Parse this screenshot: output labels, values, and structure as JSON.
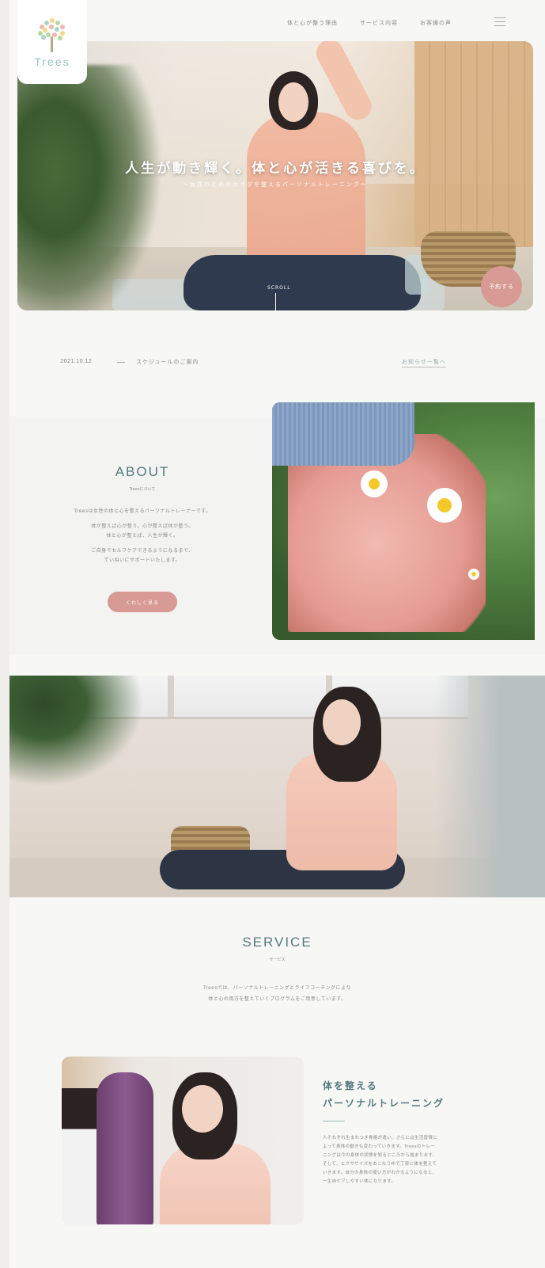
{
  "header": {
    "logo_text": "Trees",
    "nav": [
      "体と心が整う理由",
      "サービス内容",
      "お客様の声"
    ]
  },
  "hero": {
    "title": "人生が動き輝く。体と心が活きる喜びを。",
    "subtitle": "〜女性のためのカラダを整えるパーソナルトレーニング〜",
    "scroll_label": "SCROLL",
    "reserve_label": "予約する"
  },
  "news": {
    "date": "2021.10.12",
    "title": "スケジュールのご案内",
    "more_label": "お知らせ一覧へ"
  },
  "about": {
    "title": "ABOUT",
    "subtitle": "Treesについて",
    "lines": [
      "Treesは女性の体と心を整えるパーソナルトレーナーです。",
      "体が整えば心が整う。心が整えば体が整う。",
      "体と心が整えば、人生が輝く。",
      "ご自身でセルフケアできるようになるまで、",
      "ていねいにサポートいたします。"
    ],
    "button_label": "くわしく見る"
  },
  "service": {
    "title": "SERVICE",
    "subtitle": "サービス",
    "lines": [
      "Treesでは、パーソナルトレーニングとライフコーチングにより",
      "体と心の両方を整えていくプログラムをご用意しています。"
    ],
    "item": {
      "title_lines": [
        "体を整える",
        "パーソナルトレーニング"
      ],
      "body_lines": [
        "人それぞれ生まれつき骨格が違い、さらには生活習慣に",
        "よって身体の動きも変わっていきます。Treesのトレー",
        "ニングは今の身体の状態を知るところから始まります。",
        "そして、エクササイズをおこなう中で丁寧に体を整えて",
        "いきます。自分の身体の使い方がわかるようになると、",
        "一生自ケアしやすい体になります。"
      ]
    }
  },
  "colors": {
    "accent_pink": "#d79a94",
    "heading_teal": "#557a7d",
    "logo_green": "#9bc7c0"
  }
}
